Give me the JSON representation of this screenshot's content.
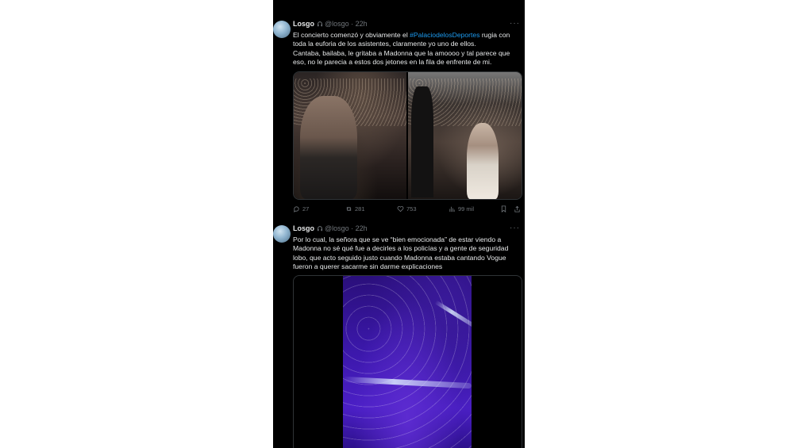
{
  "tweets": [
    {
      "name": "Losgo",
      "handle": "@losgo",
      "time": "22h",
      "text_before_tag": "El concierto comenzó y obviamente el ",
      "hashtag": "#PalaciodelosDeportes",
      "text_after_tag": " rugia con toda la euforia de los asistentes, claramente yo uno de ellos.",
      "text_line2": "Cantaba, bailaba, le gritaba a Madonna que la amoooo y tal parece que eso, no le parecia a estos dos jetones en la fila de enfrente de mi.",
      "replies": "27",
      "reposts": "281",
      "likes": "753",
      "views": "99 mil"
    },
    {
      "name": "Losgo",
      "handle": "@losgo",
      "time": "22h",
      "text": "Por lo cual, la señora que se ve “bien emocionada” de estar viendo a Madonna no sé qué fue a decirles a los policías y a gente de seguridad lobo, que acto seguido justo cuando Madonna estaba cantando Vogue fueron a querer sacarme sin darme explicaciones"
    }
  ],
  "separator": " · ",
  "more_symbol": "···",
  "colors": {
    "background": "#000000",
    "text": "#e7e9ea",
    "muted": "#71767b",
    "link": "#1d9bf0",
    "video": "#3a17a8"
  },
  "icons": [
    "reply-icon",
    "repost-icon",
    "like-icon",
    "views-icon",
    "bookmark-icon",
    "share-icon",
    "headphones-icon",
    "more-icon"
  ]
}
